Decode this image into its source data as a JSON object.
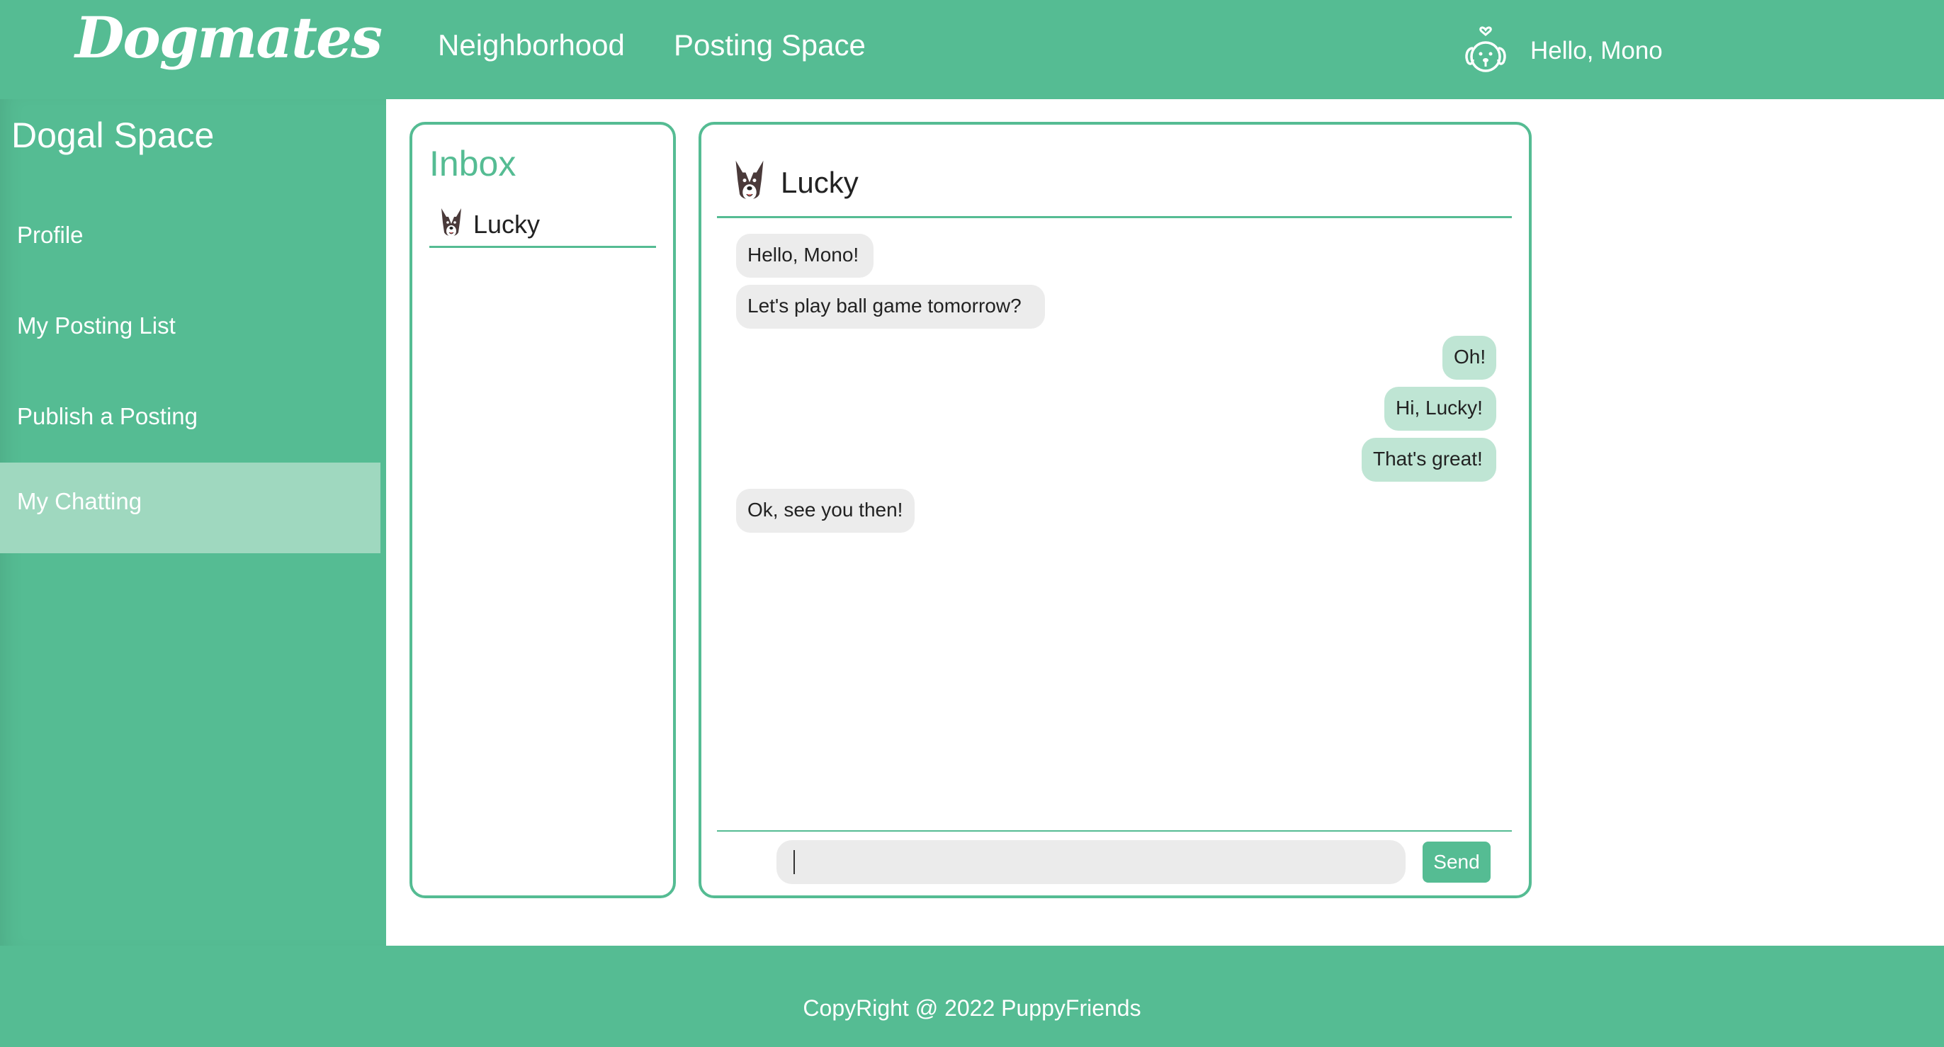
{
  "header": {
    "logo": "Dogmates",
    "nav": [
      "Neighborhood",
      "Posting Space"
    ],
    "greeting": "Hello, Mono",
    "user_icon": "dog-face-heart-icon"
  },
  "sidebar": {
    "title": "Dogal Space",
    "items": [
      {
        "label": "Profile",
        "active": false
      },
      {
        "label": "My Posting List",
        "active": false
      },
      {
        "label": "Publish a Posting",
        "active": false
      },
      {
        "label": "My Chatting",
        "active": true
      }
    ]
  },
  "inbox": {
    "title": "Inbox",
    "contacts": [
      {
        "name": "Lucky",
        "avatar": "border-collie-icon"
      }
    ]
  },
  "chat": {
    "contact_name": "Lucky",
    "avatar": "border-collie-icon",
    "messages": [
      {
        "from": "them",
        "text": "Hello, Mono!"
      },
      {
        "from": "them",
        "text": "Let's play ball game tomorrow?"
      },
      {
        "from": "me",
        "text": "Oh!"
      },
      {
        "from": "me",
        "text": "Hi, Lucky!"
      },
      {
        "from": "me",
        "text": "That's great!"
      },
      {
        "from": "them",
        "text": "Ok, see you then!"
      }
    ],
    "input_value": "",
    "send_label": "Send"
  },
  "footer": {
    "text": "CopyRight @ 2022 PuppyFriends"
  },
  "colors": {
    "accent": "#55bc93",
    "sidebar_active": "#9fd8bf",
    "bubble_me": "#bfe5d4",
    "bubble_them": "#ececec"
  }
}
